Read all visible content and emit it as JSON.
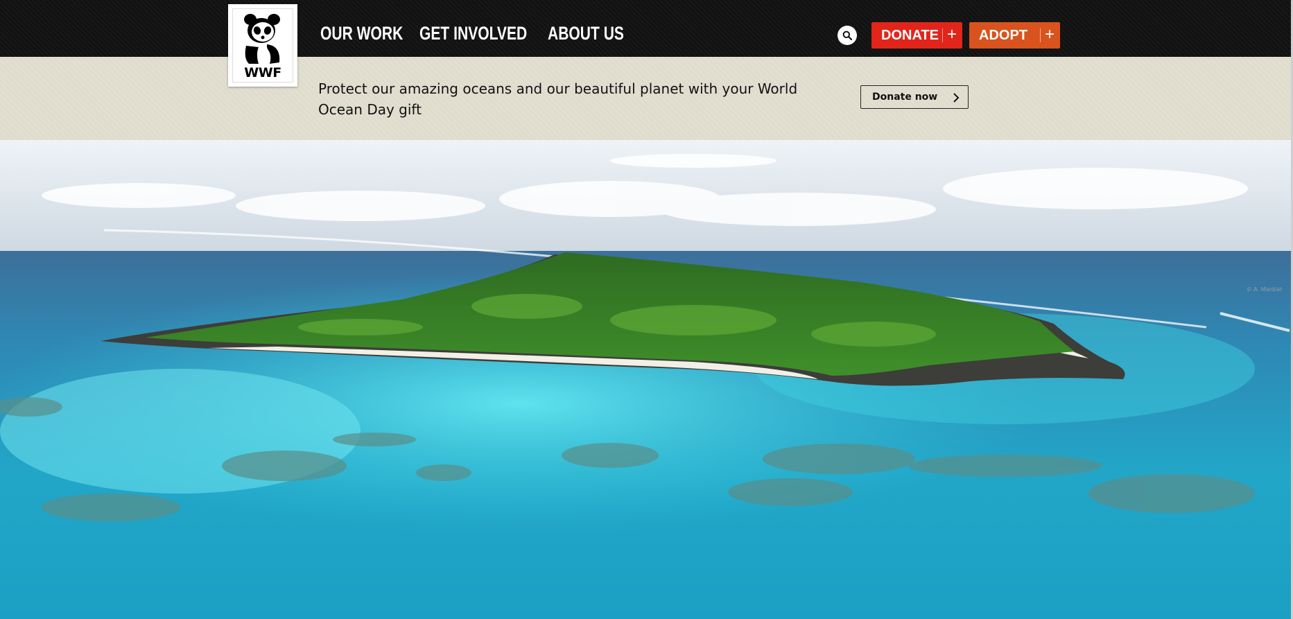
{
  "logo": {
    "text": "WWF",
    "alt": "WWF panda logo"
  },
  "nav": {
    "items": [
      {
        "label": "OUR WORK"
      },
      {
        "label": "GET INVOLVED"
      },
      {
        "label": "ABOUT US"
      }
    ]
  },
  "header": {
    "search_icon": "search-icon",
    "donate": {
      "label": "DONATE",
      "plus": "+"
    },
    "adopt": {
      "label": "ADOPT",
      "plus": "+"
    }
  },
  "banner": {
    "message": "Protect our amazing oceans and our beautiful planet with your World Ocean Day gift",
    "button_label": "Donate now"
  },
  "hero": {
    "alt": "Aerial view of a forested tropical island surrounded by turquoise reef waters",
    "credit": "© A. Mardiat"
  },
  "colors": {
    "topbar": "#111111",
    "banner": "#e2dfd1",
    "donate": "#e1251b",
    "adopt": "#d9531e",
    "ocean_deep": "#3d6f9a",
    "lagoon": "#29c3d8"
  }
}
